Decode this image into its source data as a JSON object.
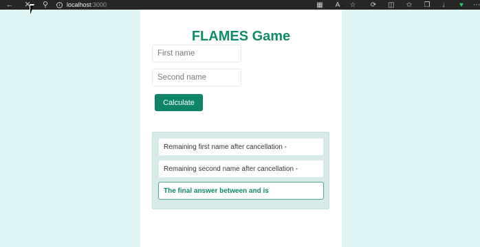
{
  "browser": {
    "url_host": "localhost",
    "url_port": ":3000"
  },
  "app": {
    "title": "FLAMES Game",
    "first_name": {
      "value": "",
      "placeholder": "First name"
    },
    "second_name": {
      "value": "",
      "placeholder": "Second name"
    },
    "calculate_label": "Calculate",
    "results": {
      "remaining_first": "Remaining first name after cancellation -",
      "remaining_second": "Remaining second name after cancellation -",
      "final_answer": "The final answer between and is"
    }
  },
  "colors": {
    "accent": "#0f8a6b",
    "button": "#0e8468",
    "page_bg": "#ddf5f4",
    "results_bg": "#d7ecea"
  },
  "icons": {
    "back": "back-arrow-icon",
    "stop": "close-icon",
    "search": "search-icon",
    "info": "info-icon"
  }
}
